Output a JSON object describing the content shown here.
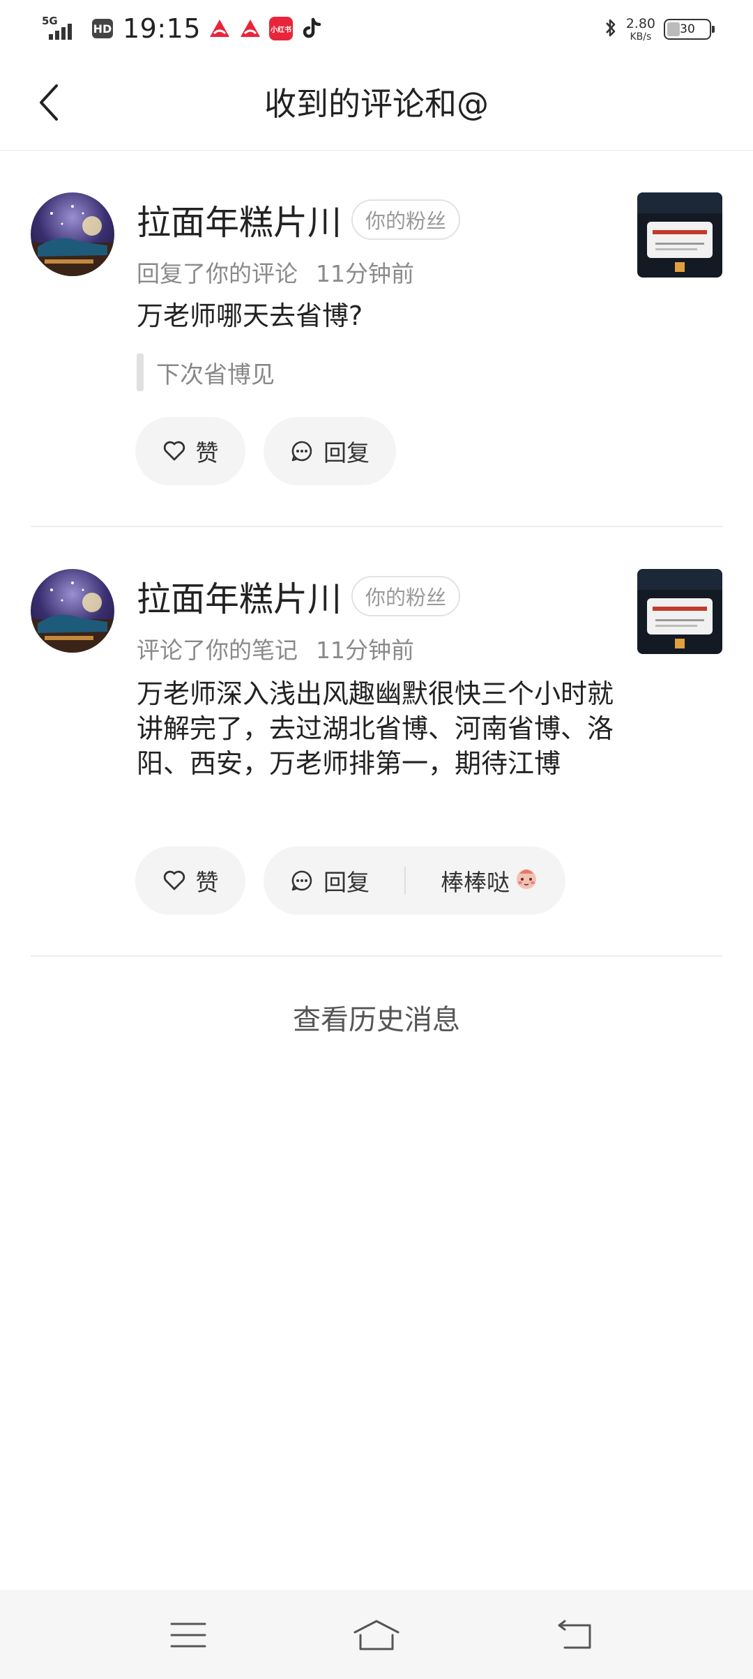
{
  "status_bar": {
    "network": "5G",
    "hd": "HD",
    "time": "19:15",
    "speed_value": "2.80",
    "speed_unit": "KB/s",
    "battery_level": "30",
    "app_badge": "小红书"
  },
  "header": {
    "title": "收到的评论和@"
  },
  "notifications": [
    {
      "user_name": "拉面年糕片川",
      "badge": "你的粉丝",
      "action": "回复了你的评论",
      "time": "11分钟前",
      "comment": "万老师哪天去省博?",
      "quote": "下次省博见",
      "like_label": "赞",
      "reply_label": "回复"
    },
    {
      "user_name": "拉面年糕片川",
      "badge": "你的粉丝",
      "action": "评论了你的笔记",
      "time": "11分钟前",
      "comment": "万老师深入浅出风趣幽默很快三个小时就讲解完了，去过湖北省博、河南省博、洛阳、西安，万老师排第一，期待江博",
      "like_label": "赞",
      "reply_label": "回复",
      "quick_reply": "棒棒哒"
    }
  ],
  "history_link": "查看历史消息",
  "colors": {
    "brand_red": "#e8253b",
    "pill_bg": "#f4f4f4",
    "meta_gray": "#8a8a8a"
  }
}
